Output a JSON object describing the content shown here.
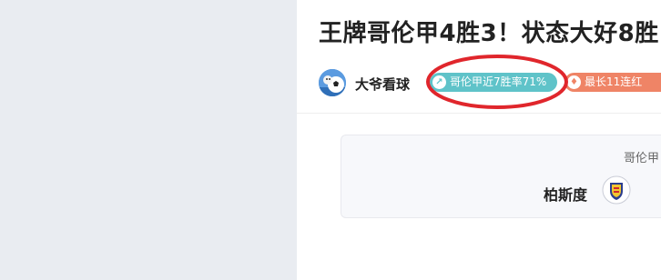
{
  "article": {
    "title": "王牌哥伦甲4胜3！状态大好8胜"
  },
  "author": {
    "name": "大爷看球",
    "avatar_icon": "football-avatar-icon"
  },
  "badges": [
    {
      "label": "哥伦甲近7胜率71%",
      "icon": "up-arrow-icon",
      "color": "#5fc3c9"
    },
    {
      "label": "最长11连红",
      "icon": "flame-icon",
      "color": "#ef8466"
    }
  ],
  "annotation": {
    "color": "#e0262c"
  },
  "match_card": {
    "league": "哥伦甲",
    "home_team": "柏斯度",
    "team_logo_icon": "team-crest-icon"
  }
}
